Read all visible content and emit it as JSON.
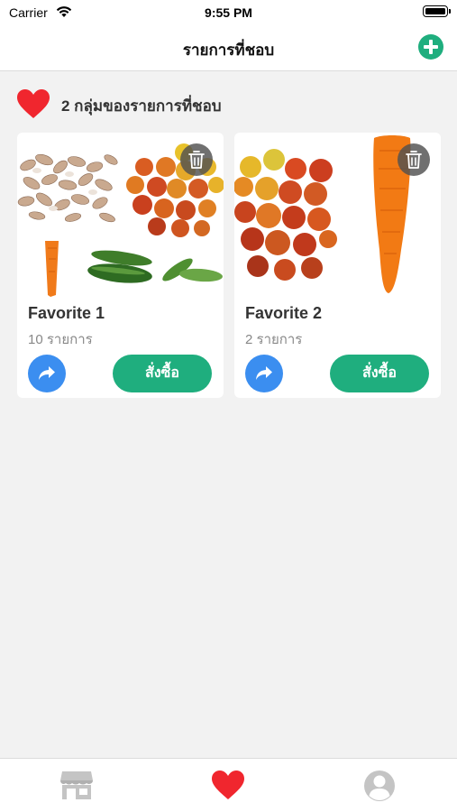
{
  "status_bar": {
    "carrier": "Carrier",
    "time": "9:55 PM"
  },
  "nav": {
    "title": "รายการที่ชอบ",
    "add_icon": "plus-circle-icon"
  },
  "group_header": {
    "icon": "heart-icon",
    "count_text": "2 กลุ่มของรายการที่ชอบ"
  },
  "favorites": [
    {
      "name": "Favorite 1",
      "count_text": "10 รายการ",
      "order_label": "สั่งซื้อ",
      "thumbnails": [
        "garlic",
        "tomatoes",
        "carrot",
        "cucumbers",
        "cucumber"
      ]
    },
    {
      "name": "Favorite 2",
      "count_text": "2 รายการ",
      "order_label": "สั่งซื้อ",
      "thumbnails": [
        "tomatoes",
        "carrot"
      ]
    }
  ],
  "tab_bar": {
    "tabs": [
      {
        "icon": "store-icon",
        "active": false
      },
      {
        "icon": "heart-icon",
        "active": true
      },
      {
        "icon": "profile-icon",
        "active": false
      }
    ]
  },
  "colors": {
    "accent_green": "#1fae7e",
    "share_blue": "#3b8ef0",
    "heart_red": "#f0262e",
    "inactive_gray": "#c4c4c4"
  }
}
